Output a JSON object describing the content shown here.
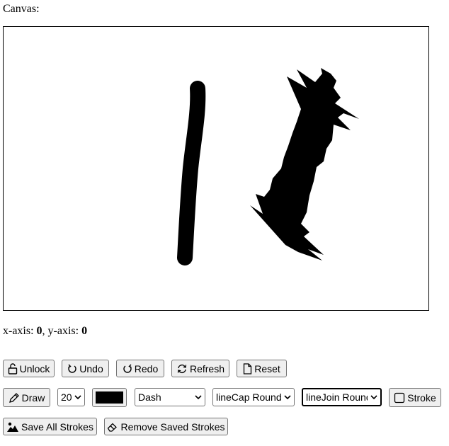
{
  "canvas": {
    "label": "Canvas:"
  },
  "coords": {
    "x_label": "x-axis:",
    "x_value": "0",
    "separator": ",",
    "y_label": "y-axis:",
    "y_value": "0"
  },
  "toolbar_row1": {
    "unlock": "Unlock",
    "undo": "Undo",
    "redo": "Redo",
    "refresh": "Refresh",
    "reset": "Reset"
  },
  "toolbar_row2": {
    "draw": "Draw",
    "line_width": "20",
    "stroke_color": "#000000",
    "line_style": "Dash",
    "line_cap": "lineCap Round",
    "line_join": "lineJoin Round",
    "stroke": "Stroke"
  },
  "toolbar_row3": {
    "save_all": "Save All Strokes",
    "remove_saved": "Remove Saved Strokes"
  },
  "icons": {
    "unlock": "unlock-icon",
    "undo": "undo-icon",
    "redo": "redo-icon",
    "refresh": "refresh-icon",
    "reset": "document-icon",
    "draw": "pencil-icon",
    "stroke": "square-icon",
    "save_all": "image-icon",
    "remove_saved": "eraser-icon"
  }
}
